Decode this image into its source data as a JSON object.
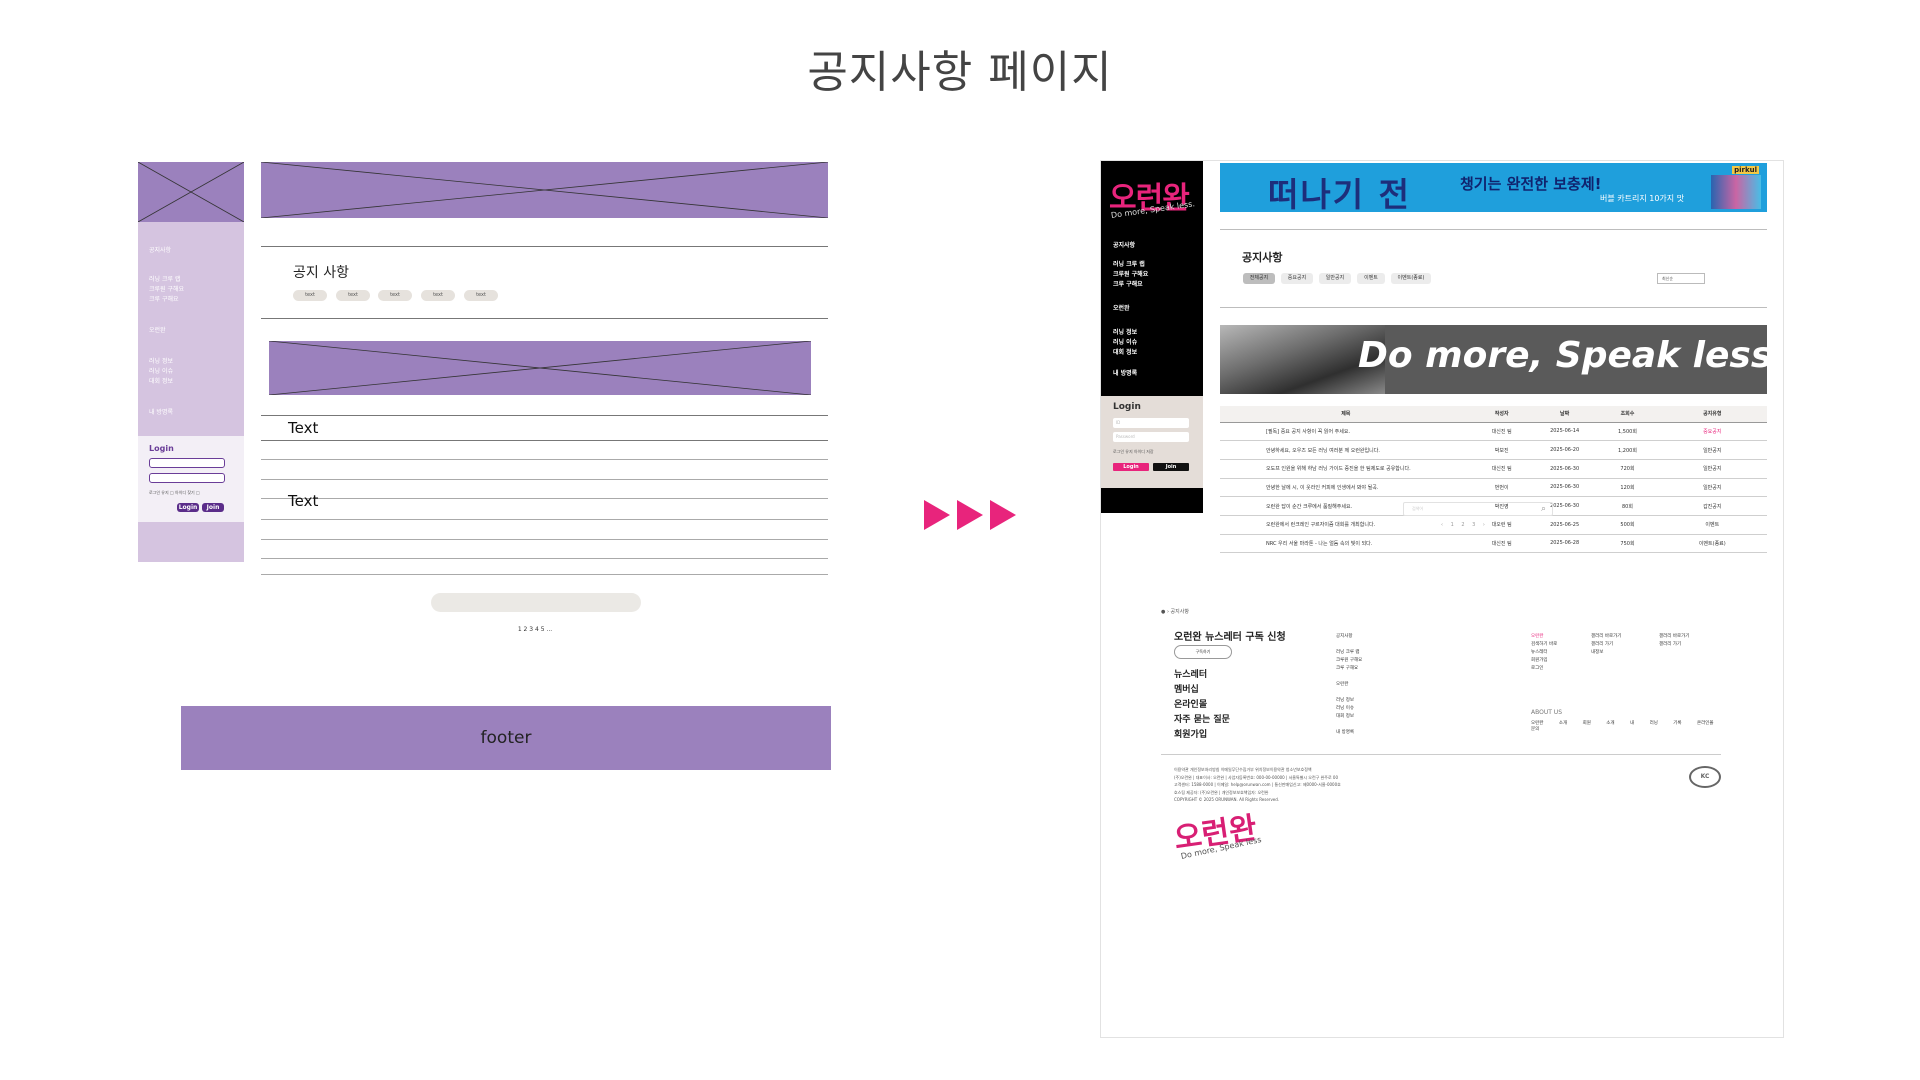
{
  "title": "공지사항 페이지",
  "wireframe": {
    "nav": [
      "공지사항",
      "러닝 크루 랩",
      "크루원 구해요",
      "크루 구해요",
      "오런완",
      "러닝 정보",
      "러닝 이슈",
      "대회 정보",
      "내 방명록"
    ],
    "login": {
      "title": "Login",
      "remember": "로그인 유지 □",
      "join_link": "아이디 찾기 □",
      "login_btn": "Login",
      "join_btn": "Join"
    },
    "notice_title": "공지 사항",
    "chips": [
      "text",
      "text",
      "text",
      "text",
      "text"
    ],
    "text_1": "Text",
    "text_2": "Text",
    "pagination": "1 2 3 4 5 ...",
    "footer": "footer"
  },
  "site": {
    "logo": "오런완",
    "logo_sub": "Do more, Speak less.",
    "nav": [
      "공지사항",
      "러닝 크루 랩",
      "크루원 구해요",
      "크루 구해요",
      "오런완",
      "러닝 정보",
      "러닝 이슈",
      "대회 정보",
      "내 방명록"
    ],
    "login": {
      "title": "Login",
      "id_placeholder": "ID",
      "pw_placeholder": "Password",
      "remember": "로그인 유지   아이디 저장",
      "login_btn": "Login",
      "join_btn": "Join"
    },
    "banner": {
      "main": "떠나기 전",
      "sub": "챙기는 완전한 보충제!",
      "sub2": "버블 카트리지 10가지 맛",
      "brand": "pirkul"
    },
    "notice_title": "공지사항",
    "chips": [
      "전체공지",
      "중요공지",
      "일반공지",
      "이벤트",
      "이벤트(종료)"
    ],
    "select": "최신순",
    "hero_text": "Do more, Speak less.",
    "table": {
      "headers": [
        "제목",
        "작성자",
        "날짜",
        "조회수",
        "공지유형"
      ],
      "rows": [
        [
          "[필독] 중요 공지 사항이 꼭 읽어 주세요.",
          "대신진 팀",
          "2025-06-14",
          "1,500회",
          "중요공지"
        ],
        [
          "안녕하세요, 오우즈 모든 러닝 여러분 께 오런완입니다.",
          "박보진",
          "2025-06-20",
          "1,200회",
          "일반공지"
        ],
        [
          "오도프 인원을 위해 하남 러닝 가이드 증진을 한 팀제도로 공유합니다.",
          "대신진 팀",
          "2025-06-30",
          "720회",
          "일반공지"
        ],
        [
          "안녕한 날에 시, 이 웃라인 커피에 인생에서 봐야 될곡.",
          "번번이",
          "2025-06-30",
          "120회",
          "일반공지"
        ],
        [
          "오런완 답이 순간 크루에서 품질해주세요.",
          "박진영",
          "2025-06-30",
          "80회",
          "갑진공지"
        ],
        [
          "오런완에서 런크레인 구르자이즘 대회를 개최합니다.",
          "대오런 팀",
          "2025-06-25",
          "500회",
          "이벤트"
        ],
        [
          "NRC 우리 서울 마라톤 - 나는 얼둠 속의 빛이 되다.",
          "대신진 팀",
          "2025-06-28",
          "750회",
          "이벤트(종료)"
        ]
      ]
    },
    "search_placeholder": "검색어",
    "pager": "‹ 1 2 3 ›",
    "footer": {
      "crumb": "● › 공지사항",
      "newsletter_title": "오런완 뉴스레터 구독 신청",
      "subscribe_btn": "구독하기",
      "menu": [
        "뉴스레터",
        "멤버십",
        "온라인몰",
        "자주 묻는 질문",
        "회원가입"
      ],
      "col1": [
        "공지사항",
        "",
        "러닝 크루 랩",
        "크루원 구해요",
        "크루 구해요",
        "",
        "오런완",
        "",
        "러닝 정보",
        "러닝 이슈",
        "대회 정보",
        "",
        "내 방명록"
      ],
      "col2": [
        "오런완",
        "검색하기 바로",
        "뉴스레터",
        "회원가입",
        "로그인"
      ],
      "col3": [
        "갤러리 바로가기",
        "갤러리 가기",
        "내정보"
      ],
      "col4": [
        "갤러리 바로가기",
        "갤러리 가기"
      ],
      "about": "ABOUT US",
      "about_links": [
        "오런완 소개",
        "회원 소개",
        "내 러닝 기록",
        "온라인몰 문의"
      ],
      "legal": [
        "이용약관   개인정보처리방침   이메일무단수집거부   위치정보이용약관   청소년보호정책",
        "(주)오런완 | 대표이사: 오런완 | 사업자등록번호: 000-00-00000 | 서울특별시 오런구 완주로 00",
        "고객센터: 1588-0000 | 이메일: help@orunwan.com | 통신판매업신고: 제0000-서울-0000호",
        "호스팅 제공자: (주)오런완 | 개인정보보호책임자: 오런완",
        "COPYRIGHT © 2025 ORUNWAN. All Rights Reserved."
      ],
      "badge": "KC",
      "logo": "오런완",
      "logo_sub": "Do more, Speak less"
    }
  }
}
